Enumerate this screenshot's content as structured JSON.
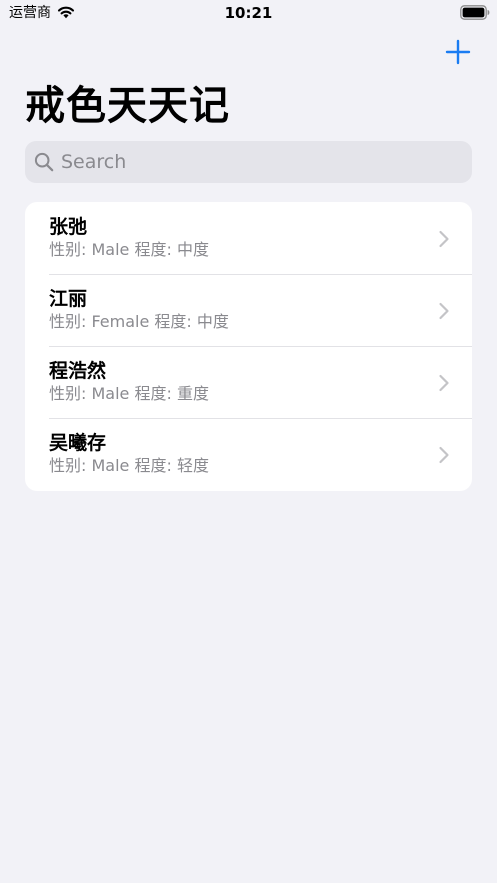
{
  "status_bar": {
    "carrier": "运营商",
    "time": "10:21"
  },
  "nav": {
    "title": "戒色天天记",
    "add_icon": "plus-icon",
    "accent_color": "#1a7cf2"
  },
  "search": {
    "placeholder": "Search",
    "value": ""
  },
  "records": [
    {
      "name": "张弛",
      "details": "性别: Male 程度: 中度"
    },
    {
      "name": "江丽",
      "details": "性别: Female 程度: 中度"
    },
    {
      "name": "程浩然",
      "details": "性别: Male 程度: 重度"
    },
    {
      "name": "吴曦存",
      "details": "性别: Male 程度: 轻度"
    }
  ],
  "colors": {
    "background": "#f2f2f7",
    "card": "#ffffff",
    "secondary_text": "#8a8a8f",
    "search_field": "#e4e4ea",
    "chevron": "#c4c4c7"
  }
}
